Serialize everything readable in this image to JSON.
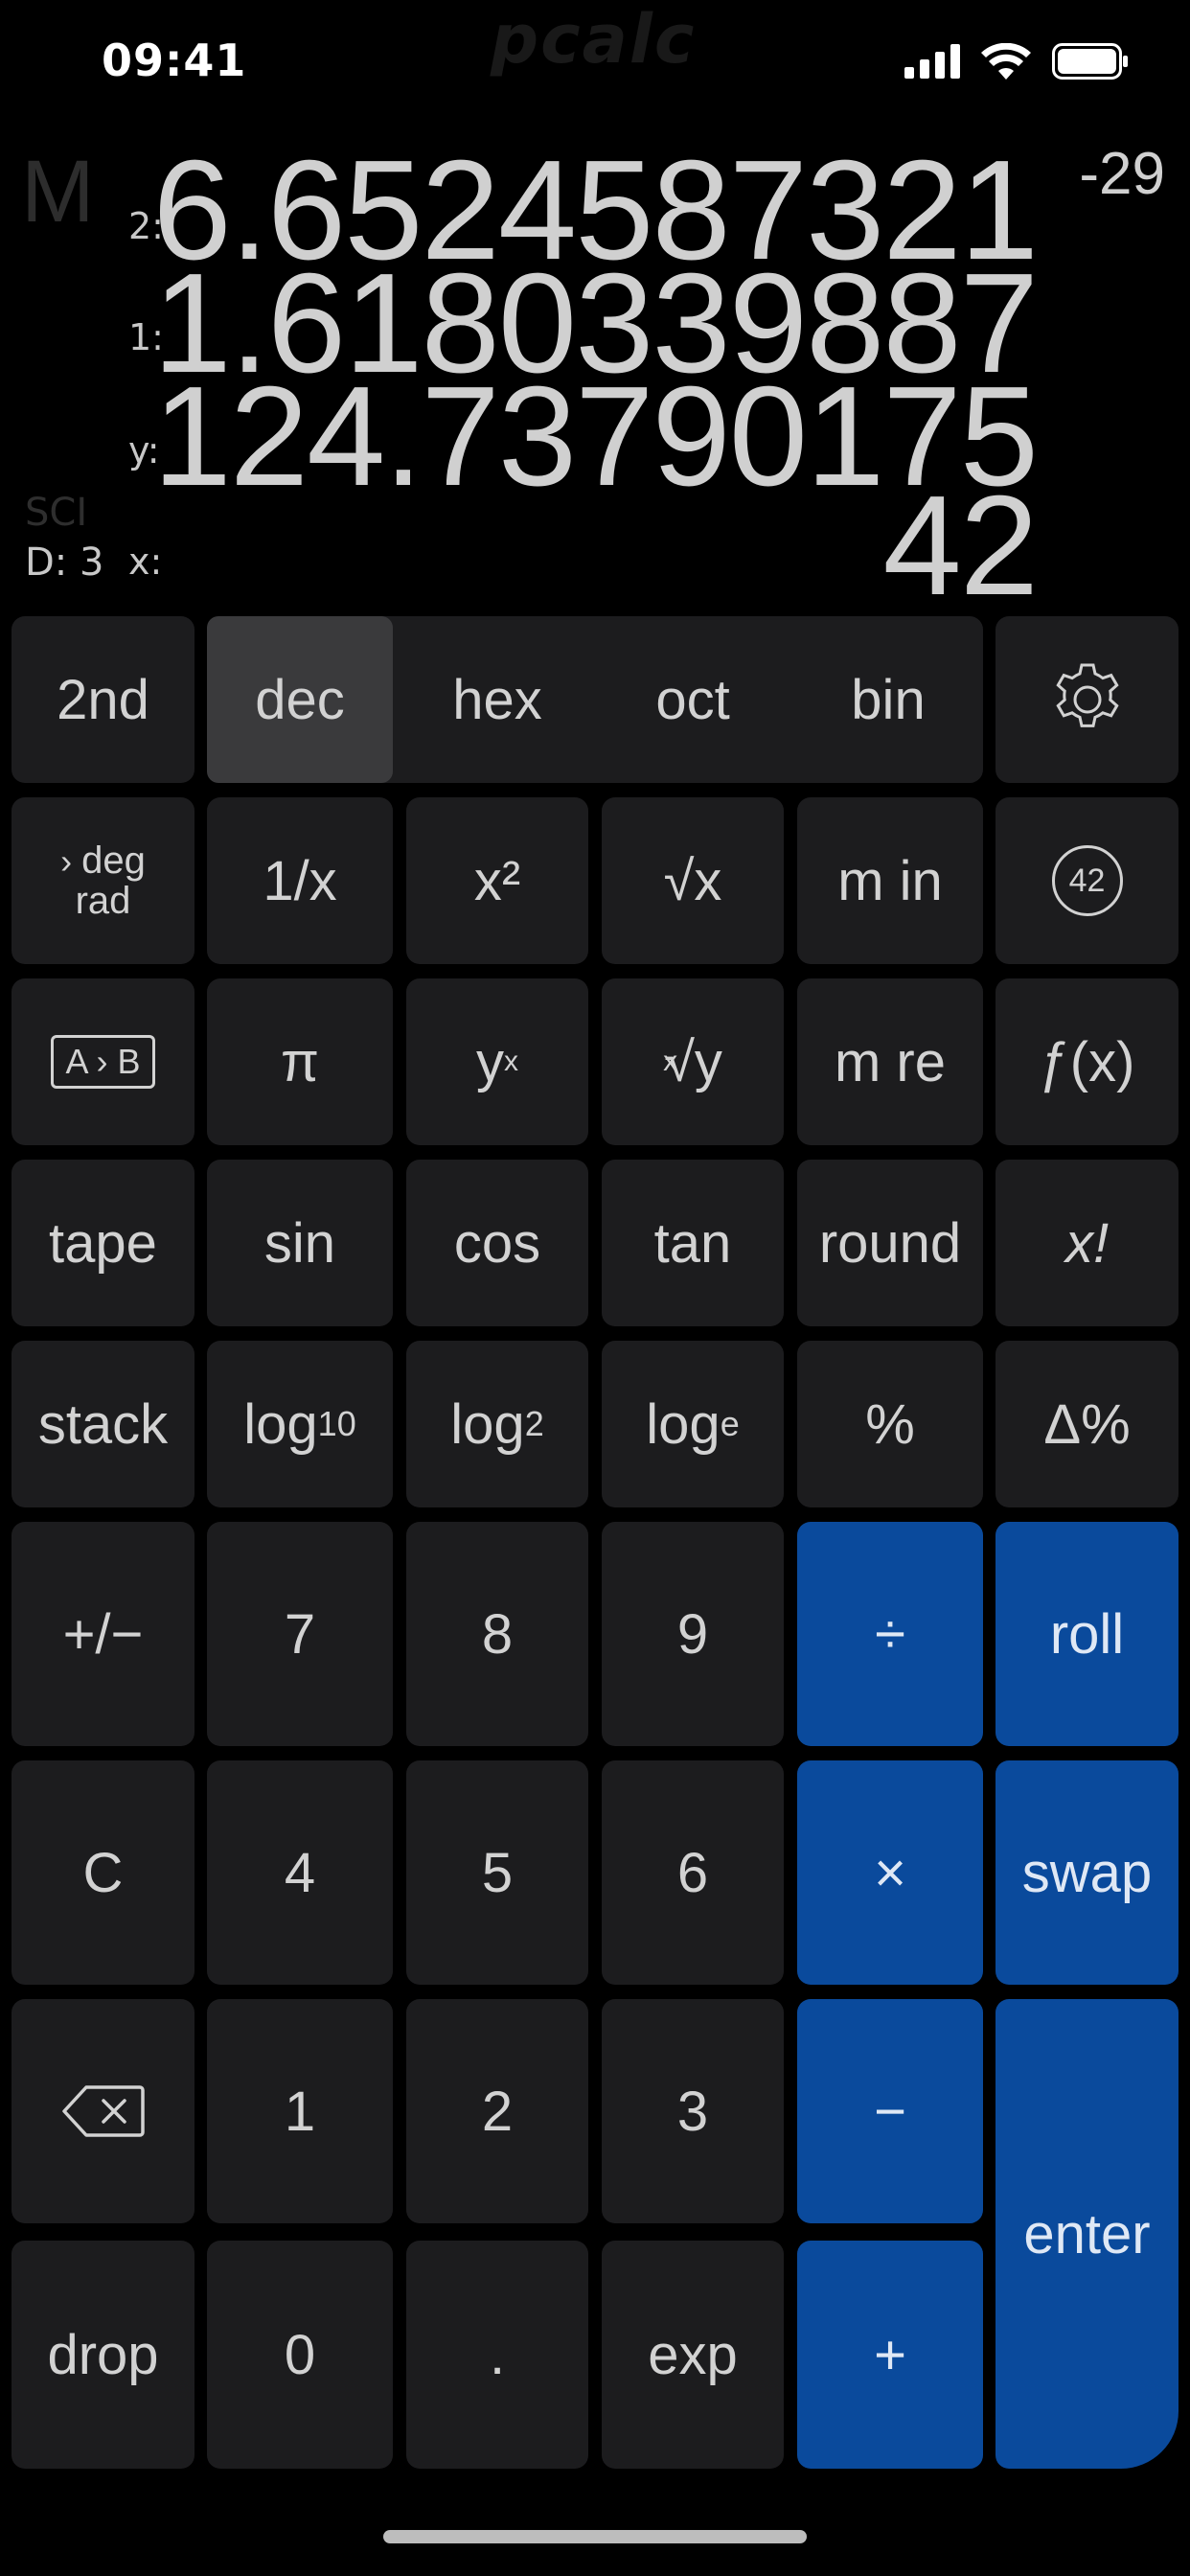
{
  "status_bar": {
    "time": "09:41"
  },
  "watermark": "pcalc",
  "display": {
    "memory_indicator": "M",
    "stack": [
      {
        "label": "2:",
        "value": "6.6524587321",
        "exponent": "-29"
      },
      {
        "label": "1:",
        "value": "1.6180339887"
      },
      {
        "label": "y:",
        "value": "124.73790175"
      },
      {
        "label": "x:",
        "value": "42"
      }
    ],
    "notation": "SCI",
    "decimals": "D: 3"
  },
  "keys": {
    "second": "2nd",
    "bases": {
      "dec": "dec",
      "hex": "hex",
      "oct": "oct",
      "bin": "bin",
      "selected": "dec"
    },
    "settings_icon": "gear-icon",
    "deg_rad_top": "deg",
    "deg_rad_bottom": "rad",
    "reciprocal": "1/x",
    "square": "x²",
    "sqrt_sym": "√",
    "sqrt_var": "x",
    "memory_in": "m in",
    "constant": "42",
    "a_to_b": "A › B",
    "pi": "π",
    "power_base": "y",
    "power_exp": "x",
    "root_idx": "x",
    "root_sym": "√",
    "root_var": "y",
    "memory_recall": "m re",
    "functions": "ƒ(x)",
    "tape": "tape",
    "sin": "sin",
    "cos": "cos",
    "tan": "tan",
    "round": "round",
    "factorial": "x!",
    "stack": "stack",
    "log": "log",
    "log10_sub": "10",
    "log2_sub": "2",
    "loge_sub": "e",
    "percent": "%",
    "delta_percent": "Δ%",
    "plus_minus": "+/−",
    "seven": "7",
    "eight": "8",
    "nine": "9",
    "divide": "÷",
    "roll": "roll",
    "clear": "C",
    "four": "4",
    "five": "5",
    "six": "6",
    "multiply": "×",
    "swap": "swap",
    "backspace_icon": "backspace-icon",
    "one": "1",
    "two": "2",
    "three": "3",
    "minus": "−",
    "enter": "enter",
    "drop": "drop",
    "zero": "0",
    "point": ".",
    "exp": "exp",
    "plus": "+"
  }
}
